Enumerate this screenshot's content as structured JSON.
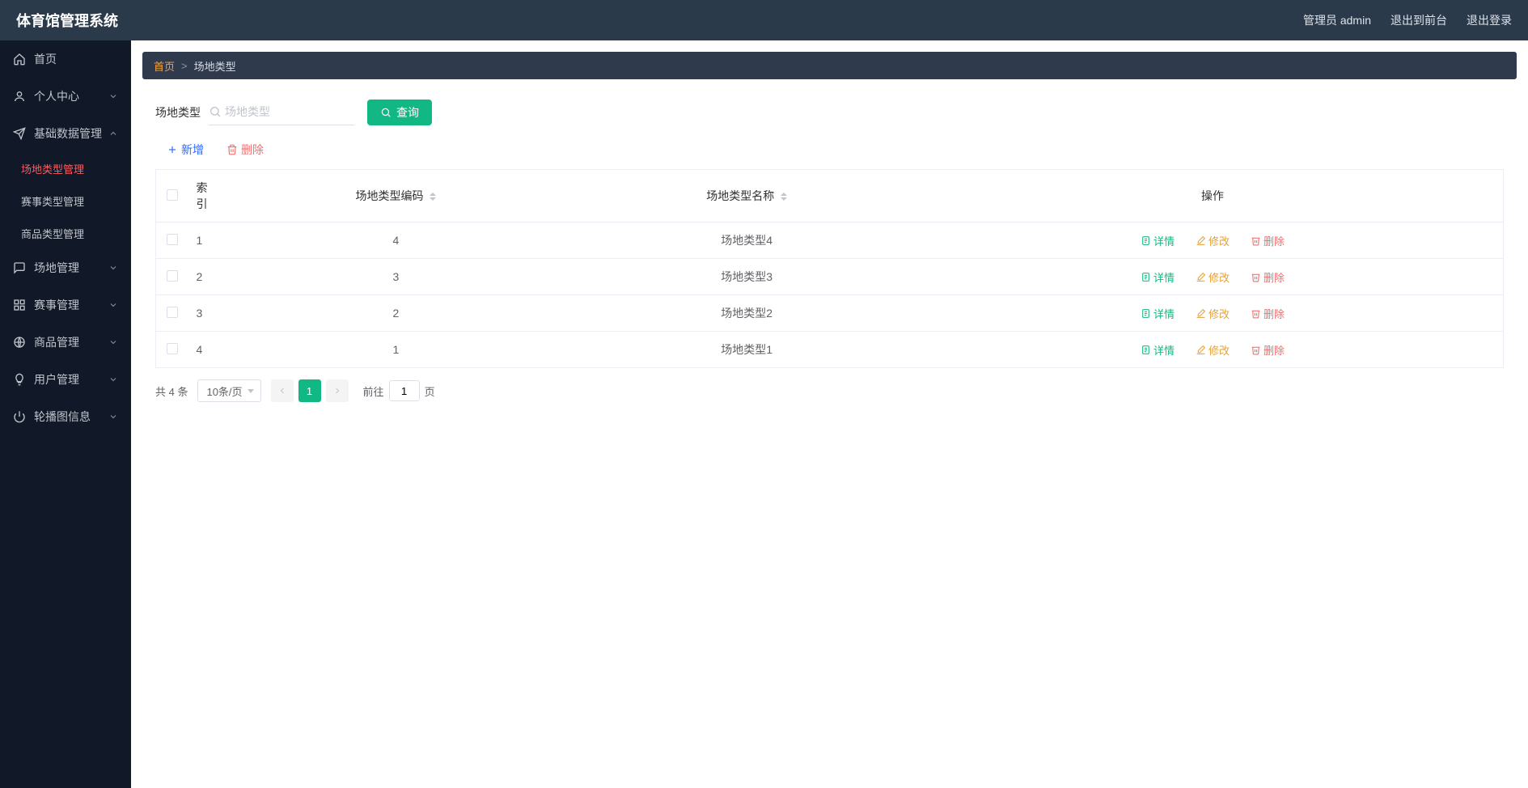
{
  "header": {
    "title": "体育馆管理系统",
    "admin_label": "管理员 admin",
    "back_front": "退出到前台",
    "logout": "退出登录"
  },
  "sidebar": {
    "items": [
      {
        "icon": "home",
        "label": "首页",
        "expandable": false
      },
      {
        "icon": "user",
        "label": "个人中心",
        "expandable": true,
        "open": false
      },
      {
        "icon": "send",
        "label": "基础数据管理",
        "expandable": true,
        "open": true,
        "children": [
          {
            "label": "场地类型管理",
            "active": true
          },
          {
            "label": "赛事类型管理",
            "active": false
          },
          {
            "label": "商品类型管理",
            "active": false
          }
        ]
      },
      {
        "icon": "chat",
        "label": "场地管理",
        "expandable": true,
        "open": false
      },
      {
        "icon": "grid",
        "label": "赛事管理",
        "expandable": true,
        "open": false
      },
      {
        "icon": "globe",
        "label": "商品管理",
        "expandable": true,
        "open": false
      },
      {
        "icon": "bulb",
        "label": "用户管理",
        "expandable": true,
        "open": false
      },
      {
        "icon": "power",
        "label": "轮播图信息",
        "expandable": true,
        "open": false
      }
    ]
  },
  "breadcrumb": {
    "home": "首页",
    "current": "场地类型"
  },
  "filter": {
    "label": "场地类型",
    "placeholder": "场地类型",
    "search_btn": "查询"
  },
  "actions": {
    "add": "新增",
    "delete": "删除"
  },
  "table": {
    "headers": {
      "index": "索引",
      "code": "场地类型编码",
      "name": "场地类型名称",
      "ops": "操作"
    },
    "ops": {
      "detail": "详情",
      "edit": "修改",
      "delete": "删除"
    },
    "rows": [
      {
        "index": "1",
        "code": "4",
        "name": "场地类型4"
      },
      {
        "index": "2",
        "code": "3",
        "name": "场地类型3"
      },
      {
        "index": "3",
        "code": "2",
        "name": "场地类型2"
      },
      {
        "index": "4",
        "code": "1",
        "name": "场地类型1"
      }
    ]
  },
  "pager": {
    "total_text": "共 4 条",
    "size_label": "10条/页",
    "current_page": "1",
    "jump_prefix": "前往",
    "jump_value": "1",
    "jump_suffix": "页"
  }
}
